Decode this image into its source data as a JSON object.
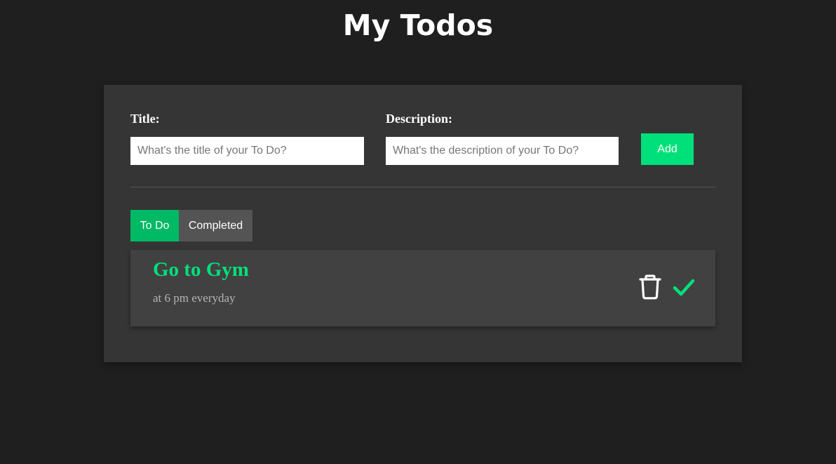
{
  "header": {
    "title": "My Todos"
  },
  "form": {
    "title_label": "Title:",
    "title_placeholder": "What's the title of your To Do?",
    "title_value": "",
    "description_label": "Description:",
    "description_placeholder": "What's the description of your To Do?",
    "description_value": "",
    "add_label": "Add"
  },
  "tabs": [
    {
      "label": "To Do",
      "active": true
    },
    {
      "label": "Completed",
      "active": false
    }
  ],
  "todos": [
    {
      "title": "Go to Gym",
      "description": "at 6 pm everyday",
      "actions": [
        {
          "icon": "trash-icon"
        },
        {
          "icon": "check-icon"
        }
      ]
    }
  ],
  "colors": {
    "background": "#1f1f1f",
    "panel": "#353535",
    "accent": "#00e07a",
    "tab_active": "#00b964",
    "tab_inactive": "#545454",
    "card": "#414141"
  }
}
